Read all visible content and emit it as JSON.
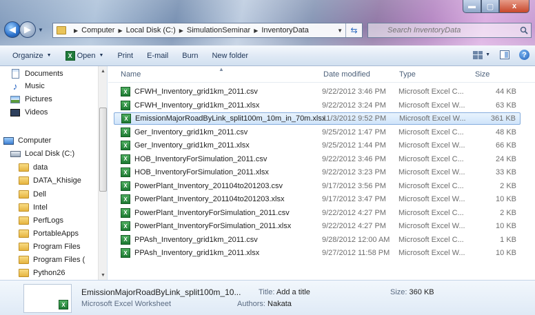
{
  "window": {
    "minimize_icon": "minimize-icon",
    "maximize_icon": "maximize-icon",
    "close_label": "x"
  },
  "address": {
    "crumbs": [
      "Computer",
      "Local Disk (C:)",
      "SimulationSeminar",
      "InventoryData"
    ]
  },
  "search": {
    "placeholder": "Search InventoryData"
  },
  "toolbar": {
    "organize": "Organize",
    "open": "Open",
    "print": "Print",
    "email": "E-mail",
    "burn": "Burn",
    "new_folder": "New folder"
  },
  "nav": {
    "items": [
      {
        "label": "Documents",
        "icon": "document-icon"
      },
      {
        "label": "Music",
        "icon": "music-icon"
      },
      {
        "label": "Pictures",
        "icon": "pictures-icon"
      },
      {
        "label": "Videos",
        "icon": "videos-icon"
      },
      {
        "label": "Computer",
        "icon": "computer-icon"
      },
      {
        "label": "Local Disk (C:)",
        "icon": "disk-icon"
      },
      {
        "label": "data",
        "icon": "folder-icon"
      },
      {
        "label": "DATA_Khisige",
        "icon": "folder-icon"
      },
      {
        "label": "Dell",
        "icon": "folder-icon"
      },
      {
        "label": "Intel",
        "icon": "folder-icon"
      },
      {
        "label": "PerfLogs",
        "icon": "folder-icon"
      },
      {
        "label": "PortableApps",
        "icon": "folder-icon"
      },
      {
        "label": "Program Files",
        "icon": "folder-icon"
      },
      {
        "label": "Program Files (",
        "icon": "folder-icon"
      },
      {
        "label": "Python26",
        "icon": "folder-icon"
      }
    ]
  },
  "columns": {
    "name": "Name",
    "date": "Date modified",
    "type": "Type",
    "size": "Size"
  },
  "files": [
    {
      "name": "CFWH_Inventory_grid1km_2011.csv",
      "date": "9/22/2012 3:46 PM",
      "type": "Microsoft Excel C...",
      "size": "44 KB"
    },
    {
      "name": "CFWH_Inventory_grid1km_2011.xlsx",
      "date": "9/22/2012 3:24 PM",
      "type": "Microsoft Excel W...",
      "size": "63 KB"
    },
    {
      "name": "EmissionMajorRoadByLink_split100m_10m_in_70m.xlsx",
      "date": "11/3/2012 9:52 PM",
      "type": "Microsoft Excel W...",
      "size": "361 KB",
      "selected": true
    },
    {
      "name": "Ger_Inventory_grid1km_2011.csv",
      "date": "9/25/2012 1:47 PM",
      "type": "Microsoft Excel C...",
      "size": "48 KB"
    },
    {
      "name": "Ger_Inventory_grid1km_2011.xlsx",
      "date": "9/25/2012 1:44 PM",
      "type": "Microsoft Excel W...",
      "size": "66 KB"
    },
    {
      "name": "HOB_InventoryForSimulation_2011.csv",
      "date": "9/22/2012 3:46 PM",
      "type": "Microsoft Excel C...",
      "size": "24 KB"
    },
    {
      "name": "HOB_InventoryForSimulation_2011.xlsx",
      "date": "9/22/2012 3:23 PM",
      "type": "Microsoft Excel W...",
      "size": "33 KB"
    },
    {
      "name": "PowerPlant_Inventory_201104to201203.csv",
      "date": "9/17/2012 3:56 PM",
      "type": "Microsoft Excel C...",
      "size": "2 KB"
    },
    {
      "name": "PowerPlant_Inventory_201104to201203.xlsx",
      "date": "9/17/2012 3:47 PM",
      "type": "Microsoft Excel W...",
      "size": "10 KB"
    },
    {
      "name": "PowerPlant_InventoryForSimulation_2011.csv",
      "date": "9/22/2012 4:27 PM",
      "type": "Microsoft Excel C...",
      "size": "2 KB"
    },
    {
      "name": "PowerPlant_InventoryForSimulation_2011.xlsx",
      "date": "9/22/2012 4:27 PM",
      "type": "Microsoft Excel W...",
      "size": "10 KB"
    },
    {
      "name": "PPAsh_Inventory_grid1km_2011.csv",
      "date": "9/28/2012 12:00 AM",
      "type": "Microsoft Excel C...",
      "size": "1 KB"
    },
    {
      "name": "PPAsh_Inventory_grid1km_2011.xlsx",
      "date": "9/27/2012 11:58 PM",
      "type": "Microsoft Excel W...",
      "size": "10 KB"
    }
  ],
  "details": {
    "name": "EmissionMajorRoadByLink_split100m_10...",
    "type": "Microsoft Excel Worksheet",
    "title_label": "Title:",
    "title_value": "Add a title",
    "authors_label": "Authors:",
    "authors_value": "Nakata",
    "size_label": "Size:",
    "size_value": "360 KB"
  },
  "colors": {
    "selection_border": "#84acdd",
    "toolbar_text": "#1e3557",
    "excel_green": "#1d7a32"
  }
}
